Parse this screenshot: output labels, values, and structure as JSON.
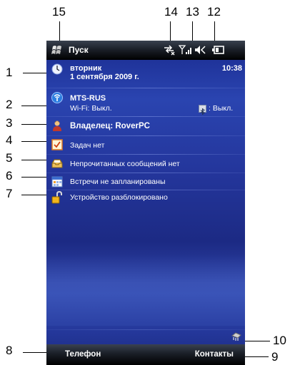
{
  "callouts": [
    "1",
    "2",
    "3",
    "4",
    "5",
    "6",
    "7",
    "8",
    "9",
    "10",
    "12",
    "13",
    "14",
    "15"
  ],
  "taskbar": {
    "start_label": "Пуск"
  },
  "today": {
    "day": "вторник",
    "date": "1 сентября 2009 г.",
    "time": "10:38",
    "operator": "MTS-RUS",
    "wifi_status": "Wi-Fi: Выкл.",
    "bt_status": ": Выкл.",
    "owner": "Владелец: RoverPC",
    "tasks": "Задач нет",
    "messages": "Непрочитанных сообщений нет",
    "appointments": "Встречи не запланированы",
    "lock_status": "Устройство разблокировано"
  },
  "softkeys": {
    "left": "Телефон",
    "right": "Контакты"
  },
  "colors": {
    "accent": "#2a44b0",
    "bar": "#000000"
  }
}
